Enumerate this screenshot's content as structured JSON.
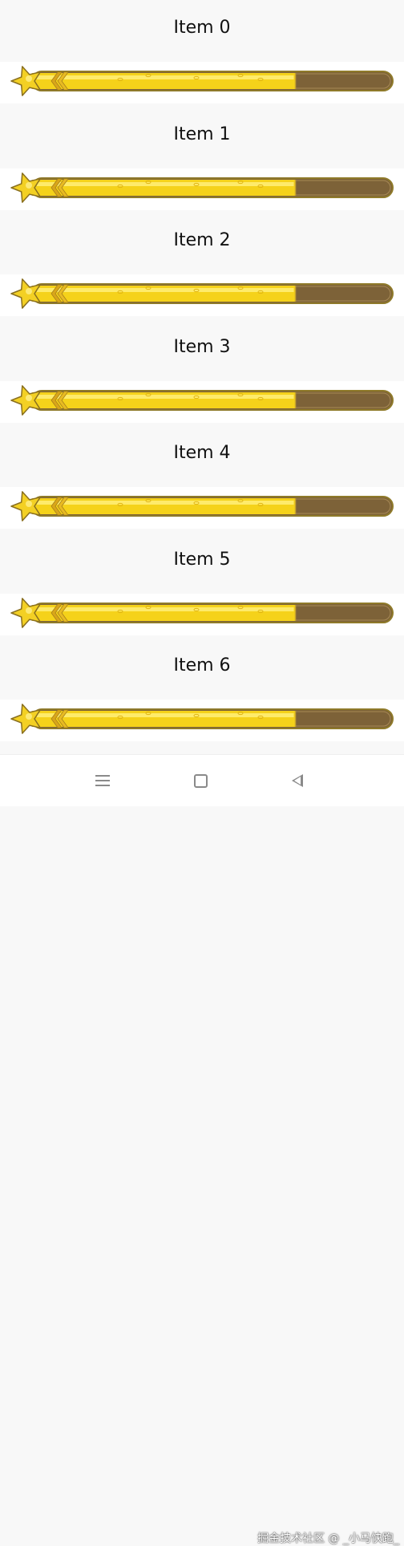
{
  "list": {
    "items": [
      {
        "title": "Item 0",
        "progress": 0.73
      },
      {
        "title": "Item 1",
        "progress": 0.73
      },
      {
        "title": "Item 2",
        "progress": 0.73
      },
      {
        "title": "Item 3",
        "progress": 0.73
      },
      {
        "title": "Item 4",
        "progress": 0.73
      },
      {
        "title": "Item 5",
        "progress": 0.73
      },
      {
        "title": "Item 6",
        "progress": 0.73
      }
    ]
  },
  "colors": {
    "fill_yellow": "#f5d21a",
    "fill_highlight": "#fff07a",
    "track_brown": "#7d6238",
    "outline": "#8f7a2a",
    "star": "#f3d024",
    "background": "#f8f8f8",
    "band": "#ffffff"
  },
  "navbar": {
    "menu_icon": "menu-lines-icon",
    "home_icon": "square-home-icon",
    "back_icon": "triangle-back-icon"
  },
  "watermark": {
    "text": "掘金技术社区 @ _小马快跑_"
  }
}
